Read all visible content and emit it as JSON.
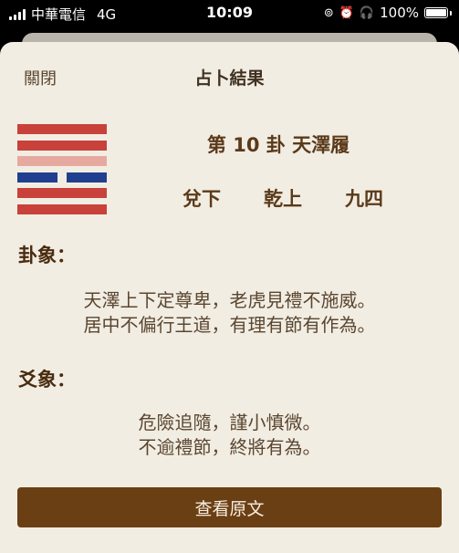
{
  "status_bar": {
    "carrier": "中華電信",
    "network": "4G",
    "time": "10:09",
    "battery": "100%"
  },
  "modal": {
    "close_label": "關閉",
    "title": "占卜結果"
  },
  "hexagram": {
    "name": "第 10 卦 天澤履",
    "lower_trigram": "兌下",
    "upper_trigram": "乾上",
    "changing_line": "九四",
    "lines_top_to_bottom": [
      {
        "type": "yang",
        "color": "#c8413a"
      },
      {
        "type": "yang",
        "color": "#c8413a"
      },
      {
        "type": "yang",
        "color": "#e6a9a0"
      },
      {
        "type": "yin",
        "color": "#213f8f"
      },
      {
        "type": "yang",
        "color": "#c8413a"
      },
      {
        "type": "yang",
        "color": "#c8413a"
      }
    ]
  },
  "gua_image": {
    "heading": "卦象：",
    "line1": "天澤上下定尊卑，老虎見禮不施威。",
    "line2": "居中不偏行王道，有理有節有作為。"
  },
  "yao_image": {
    "heading": "爻象：",
    "line1": "危險追隨，謹小慎微。",
    "line2": "不逾禮節，終將有為。"
  },
  "actions": {
    "view_original": "查看原文"
  },
  "colors": {
    "sheet_bg": "#f2ede3",
    "accent_brown": "#6b3f14",
    "text_brown": "#5b3a1a"
  }
}
